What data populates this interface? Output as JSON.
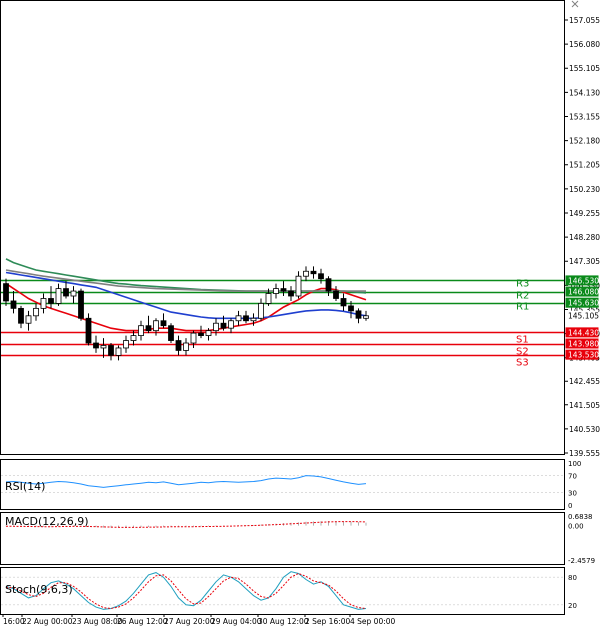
{
  "chart_data": {
    "type": "candlestick",
    "main": {
      "y_ticks": [
        "157.055",
        "156.080",
        "155.105",
        "154.130",
        "153.155",
        "152.180",
        "151.205",
        "150.230",
        "149.255",
        "148.280",
        "147.305",
        "146.330",
        "145.355",
        "144.380",
        "143.405",
        "142.455",
        "141.505",
        "140.530",
        "139.555"
      ],
      "ylim": [
        139.555,
        157.5
      ],
      "price_labels": [
        {
          "text": "146.530",
          "value": 146.53,
          "bg": "#0a8a1a",
          "fg": "#ffffff"
        },
        {
          "text": "146.080",
          "value": 146.08,
          "bg": "#0a8a1a",
          "fg": "#ffffff"
        },
        {
          "text": "145.630",
          "value": 145.63,
          "bg": "#0a8a1a",
          "fg": "#ffffff"
        },
        {
          "text": "145.105",
          "value": 145.105,
          "bg": "#ffffff",
          "fg": "#000000"
        },
        {
          "text": "144.430",
          "value": 144.43,
          "bg": "#e8000b",
          "fg": "#ffffff"
        },
        {
          "text": "143.980",
          "value": 143.98,
          "bg": "#e8000b",
          "fg": "#ffffff"
        },
        {
          "text": "143.530",
          "value": 143.53,
          "bg": "#e8000b",
          "fg": "#ffffff"
        }
      ],
      "levels": [
        {
          "name": "R3",
          "value": 146.53,
          "color": "#0a8a1a"
        },
        {
          "name": "R2",
          "value": 146.08,
          "color": "#0a8a1a"
        },
        {
          "name": "R1",
          "value": 145.63,
          "color": "#0a8a1a"
        },
        {
          "name": "S1",
          "value": 144.43,
          "color": "#e8000b"
        },
        {
          "name": "S2",
          "value": 143.98,
          "color": "#e8000b"
        },
        {
          "name": "S3",
          "value": 143.53,
          "color": "#e8000b"
        }
      ],
      "candles": [
        [
          146.4,
          146.6,
          145.5,
          145.7
        ],
        [
          145.7,
          146.1,
          145.2,
          145.4
        ],
        [
          145.4,
          145.5,
          144.6,
          144.8
        ],
        [
          144.8,
          145.3,
          144.5,
          145.1
        ],
        [
          145.1,
          145.6,
          144.9,
          145.4
        ],
        [
          145.4,
          146.0,
          145.2,
          145.8
        ],
        [
          145.8,
          146.3,
          145.4,
          145.6
        ],
        [
          145.6,
          146.4,
          145.5,
          146.2
        ],
        [
          146.2,
          146.5,
          145.8,
          145.9
        ],
        [
          145.9,
          146.3,
          145.6,
          146.1
        ],
        [
          146.1,
          146.2,
          144.9,
          145.0
        ],
        [
          145.0,
          145.2,
          143.9,
          144.0
        ],
        [
          144.0,
          144.3,
          143.6,
          143.8
        ],
        [
          143.8,
          144.2,
          143.4,
          143.9
        ],
        [
          143.9,
          144.0,
          143.3,
          143.5
        ],
        [
          143.5,
          143.9,
          143.3,
          143.8
        ],
        [
          143.8,
          144.3,
          143.6,
          144.1
        ],
        [
          144.1,
          144.5,
          143.9,
          144.3
        ],
        [
          144.3,
          144.9,
          144.1,
          144.7
        ],
        [
          144.7,
          145.1,
          144.4,
          144.5
        ],
        [
          144.5,
          145.0,
          144.3,
          144.9
        ],
        [
          144.9,
          145.2,
          144.6,
          144.7
        ],
        [
          144.7,
          144.8,
          144.0,
          144.1
        ],
        [
          144.1,
          144.3,
          143.5,
          143.7
        ],
        [
          143.7,
          144.2,
          143.5,
          144.0
        ],
        [
          144.0,
          144.5,
          143.8,
          144.4
        ],
        [
          144.4,
          144.7,
          144.2,
          144.3
        ],
        [
          144.3,
          144.6,
          144.1,
          144.5
        ],
        [
          144.5,
          145.0,
          144.3,
          144.8
        ],
        [
          144.8,
          145.1,
          144.5,
          144.6
        ],
        [
          144.6,
          145.0,
          144.4,
          144.9
        ],
        [
          144.9,
          145.3,
          144.7,
          145.1
        ],
        [
          145.1,
          145.3,
          144.8,
          144.9
        ],
        [
          144.9,
          145.2,
          144.7,
          145.0
        ],
        [
          145.0,
          145.8,
          144.9,
          145.6
        ],
        [
          145.6,
          146.2,
          145.5,
          146.0
        ],
        [
          146.0,
          146.4,
          145.8,
          146.2
        ],
        [
          146.2,
          146.5,
          145.9,
          146.1
        ],
        [
          146.1,
          146.3,
          145.7,
          145.9
        ],
        [
          145.9,
          146.9,
          145.8,
          146.7
        ],
        [
          146.7,
          147.1,
          146.5,
          146.9
        ],
        [
          146.9,
          147.1,
          146.6,
          146.8
        ],
        [
          146.8,
          147.0,
          146.4,
          146.6
        ],
        [
          146.6,
          146.7,
          145.9,
          146.1
        ],
        [
          146.1,
          146.3,
          145.7,
          145.8
        ],
        [
          145.8,
          146.0,
          145.3,
          145.5
        ],
        [
          145.5,
          145.7,
          145.0,
          145.3
        ],
        [
          145.3,
          145.4,
          144.8,
          145.0
        ],
        [
          145.0,
          145.3,
          144.9,
          145.1
        ]
      ],
      "ma_series": [
        {
          "color": "#e8000b",
          "values": [
            146.4,
            146.2,
            146.0,
            145.8,
            145.65,
            145.5,
            145.4,
            145.3,
            145.2,
            145.1,
            145.0,
            144.9,
            144.8,
            144.7,
            144.6,
            144.55,
            144.5,
            144.5,
            144.5,
            144.55,
            144.6,
            144.6,
            144.6,
            144.55,
            144.5,
            144.5,
            144.5,
            144.5,
            144.55,
            144.6,
            144.65,
            144.7,
            144.75,
            144.8,
            144.9,
            145.05,
            145.25,
            145.45,
            145.6,
            145.75,
            145.95,
            146.1,
            146.2,
            146.2,
            146.15,
            146.05,
            145.95,
            145.85,
            145.75
          ]
        },
        {
          "color": "#1f3fcf",
          "values": [
            146.85,
            146.8,
            146.75,
            146.7,
            146.65,
            146.6,
            146.55,
            146.5,
            146.45,
            146.4,
            146.35,
            146.3,
            146.25,
            146.15,
            146.05,
            145.95,
            145.85,
            145.75,
            145.65,
            145.55,
            145.45,
            145.35,
            145.25,
            145.2,
            145.15,
            145.1,
            145.05,
            145.02,
            145.0,
            145.0,
            145.0,
            145.0,
            145.0,
            145.0,
            145.02,
            145.05,
            145.1,
            145.15,
            145.2,
            145.25,
            145.3,
            145.32,
            145.34,
            145.34,
            145.32,
            145.28,
            145.22,
            145.15,
            145.1
          ]
        },
        {
          "color": "#2e8b57",
          "values": [
            147.4,
            147.25,
            147.15,
            147.05,
            146.95,
            146.9,
            146.85,
            146.8,
            146.75,
            146.7,
            146.65,
            146.6,
            146.55,
            146.5,
            146.45,
            146.4,
            146.38,
            146.35,
            146.32,
            146.3,
            146.28,
            146.26,
            146.24,
            146.22,
            146.2,
            146.18,
            146.16,
            146.15,
            146.14,
            146.13,
            146.12,
            146.11,
            146.1,
            146.1,
            146.1,
            146.1,
            146.1,
            146.1,
            146.1,
            146.1,
            146.1,
            146.1,
            146.1,
            146.1,
            146.1,
            146.1,
            146.08,
            146.05,
            146.02
          ]
        },
        {
          "color": "#808080",
          "values": [
            146.95,
            146.9,
            146.85,
            146.8,
            146.75,
            146.7,
            146.66,
            146.62,
            146.58,
            146.54,
            146.5,
            146.46,
            146.42,
            146.38,
            146.34,
            146.3,
            146.28,
            146.26,
            146.24,
            146.22,
            146.2,
            146.19,
            146.18,
            146.17,
            146.16,
            146.15,
            146.14,
            146.13,
            146.12,
            146.11,
            146.1,
            146.1,
            146.1,
            146.1,
            146.1,
            146.1,
            146.1,
            146.1,
            146.1,
            146.1,
            146.1,
            146.1,
            146.1,
            146.1,
            146.1,
            146.1,
            146.1,
            146.1,
            146.1
          ]
        }
      ]
    },
    "rsi": {
      "label": "RSI(14)",
      "ticks": [
        "100",
        "70",
        "30",
        "0"
      ],
      "color": "#1e90ff",
      "values": [
        55,
        56,
        54,
        52,
        50,
        52,
        54,
        56,
        55,
        53,
        50,
        46,
        44,
        42,
        44,
        46,
        48,
        50,
        52,
        54,
        53,
        55,
        52,
        48,
        50,
        52,
        54,
        53,
        55,
        56,
        55,
        54,
        55,
        56,
        58,
        62,
        64,
        63,
        62,
        65,
        70,
        69,
        67,
        63,
        59,
        55,
        52,
        49,
        51
      ]
    },
    "macd": {
      "label": "MACD(12,26,9)",
      "ticks": [
        "0.6838",
        "0.00",
        "-2.4579"
      ],
      "range": [
        -2.4579,
        0.6838
      ],
      "histogram": [
        -0.05,
        -0.08,
        -0.1,
        -0.12,
        -0.13,
        -0.12,
        -0.1,
        -0.08,
        -0.07,
        -0.06,
        -0.08,
        -0.12,
        -0.16,
        -0.2,
        -0.22,
        -0.22,
        -0.2,
        -0.18,
        -0.16,
        -0.14,
        -0.12,
        -0.1,
        -0.1,
        -0.12,
        -0.12,
        -0.1,
        -0.08,
        -0.07,
        -0.05,
        -0.03,
        0.0,
        0.02,
        0.04,
        0.06,
        0.1,
        0.15,
        0.2,
        0.25,
        0.28,
        0.32,
        0.38,
        0.42,
        0.45,
        0.46,
        0.45,
        0.42,
        0.38,
        0.34,
        0.3
      ],
      "signal": [
        -0.06,
        -0.07,
        -0.08,
        -0.09,
        -0.1,
        -0.11,
        -0.11,
        -0.1,
        -0.09,
        -0.08,
        -0.08,
        -0.09,
        -0.11,
        -0.13,
        -0.15,
        -0.17,
        -0.18,
        -0.18,
        -0.17,
        -0.16,
        -0.15,
        -0.13,
        -0.12,
        -0.12,
        -0.12,
        -0.11,
        -0.1,
        -0.09,
        -0.08,
        -0.07,
        -0.05,
        -0.03,
        -0.01,
        0.01,
        0.04,
        0.07,
        0.1,
        0.14,
        0.18,
        0.22,
        0.26,
        0.3,
        0.34,
        0.37,
        0.39,
        0.4,
        0.4,
        0.39,
        0.37
      ]
    },
    "stoch": {
      "label": "Stoch(9,6,3)",
      "ticks": [
        "80",
        "20"
      ],
      "main_color": "#1f9fbf",
      "signal_color": "#e8000b",
      "main": [
        60,
        55,
        45,
        35,
        40,
        55,
        68,
        72,
        65,
        55,
        40,
        25,
        15,
        10,
        12,
        18,
        28,
        45,
        65,
        85,
        90,
        80,
        60,
        35,
        20,
        18,
        30,
        50,
        70,
        85,
        80,
        70,
        55,
        40,
        30,
        35,
        55,
        80,
        92,
        88,
        75,
        65,
        70,
        60,
        40,
        20,
        15,
        10,
        12
      ],
      "signal": [
        58,
        57,
        50,
        42,
        38,
        45,
        58,
        68,
        68,
        60,
        48,
        33,
        22,
        14,
        12,
        15,
        22,
        35,
        52,
        70,
        83,
        85,
        72,
        52,
        33,
        22,
        24,
        38,
        55,
        72,
        80,
        77,
        65,
        50,
        38,
        35,
        45,
        62,
        80,
        88,
        82,
        72,
        68,
        63,
        50,
        33,
        20,
        14,
        12
      ]
    },
    "x_labels": [
      "16:00",
      "22 Aug 00:00",
      "23 Aug 08:00",
      "26 Aug 12:00",
      "27 Aug 20:00",
      "29 Aug 04:00",
      "30 Aug 12:00",
      "2 Sep 16:00",
      "4 Sep 00:00"
    ]
  }
}
